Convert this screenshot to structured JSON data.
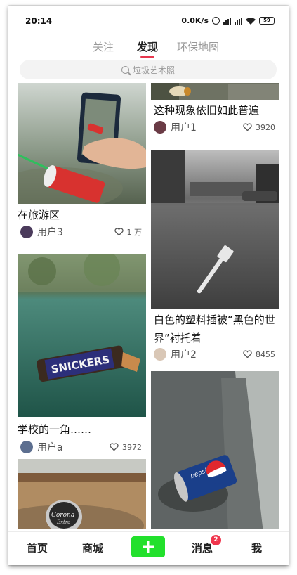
{
  "status_bar": {
    "time": "20:14",
    "net_speed": "0.0K/s",
    "battery": "59",
    "icons": [
      "alarm-icon",
      "hd-signal-icon",
      "signal-icon",
      "wifi-icon",
      "battery-icon"
    ]
  },
  "top_tabs": [
    {
      "label": "关注",
      "active": false
    },
    {
      "label": "发现",
      "active": true
    },
    {
      "label": "环保地图",
      "active": false
    }
  ],
  "search": {
    "placeholder": "垃圾艺术照",
    "icon": "search-icon"
  },
  "feed": {
    "left": [
      {
        "title": "在旅游区",
        "user": "用户3",
        "likes": "1 万",
        "image": "hand-holding-phone-photo-of-red-cup"
      },
      {
        "title": "学校的一角……",
        "user": "用户a",
        "likes": "3972",
        "image": "snickers-wrapper-on-green-track"
      },
      {
        "title": "",
        "user": "",
        "likes": "",
        "image": "corona-bottle-cap-on-sand"
      }
    ],
    "right": [
      {
        "title": "这种现象依旧如此普遍",
        "user": "用户1",
        "likes": "3920",
        "image": "trash-on-ground-partial"
      },
      {
        "title": "白色的塑料插被“黑色的世界”衬托着",
        "user": "用户2",
        "likes": "8455",
        "image": "white-plastic-fork-on-asphalt"
      },
      {
        "title": "",
        "user": "",
        "likes": "",
        "image": "pepsi-can-in-gutter"
      }
    ]
  },
  "bottom_nav": {
    "items": [
      "首页",
      "商城",
      "消息",
      "我"
    ],
    "messages_badge": "2",
    "add_icon": "plus-icon"
  },
  "colors": {
    "accent": "#e8384f",
    "add_button": "#22e02c",
    "badge": "#f0364d"
  }
}
